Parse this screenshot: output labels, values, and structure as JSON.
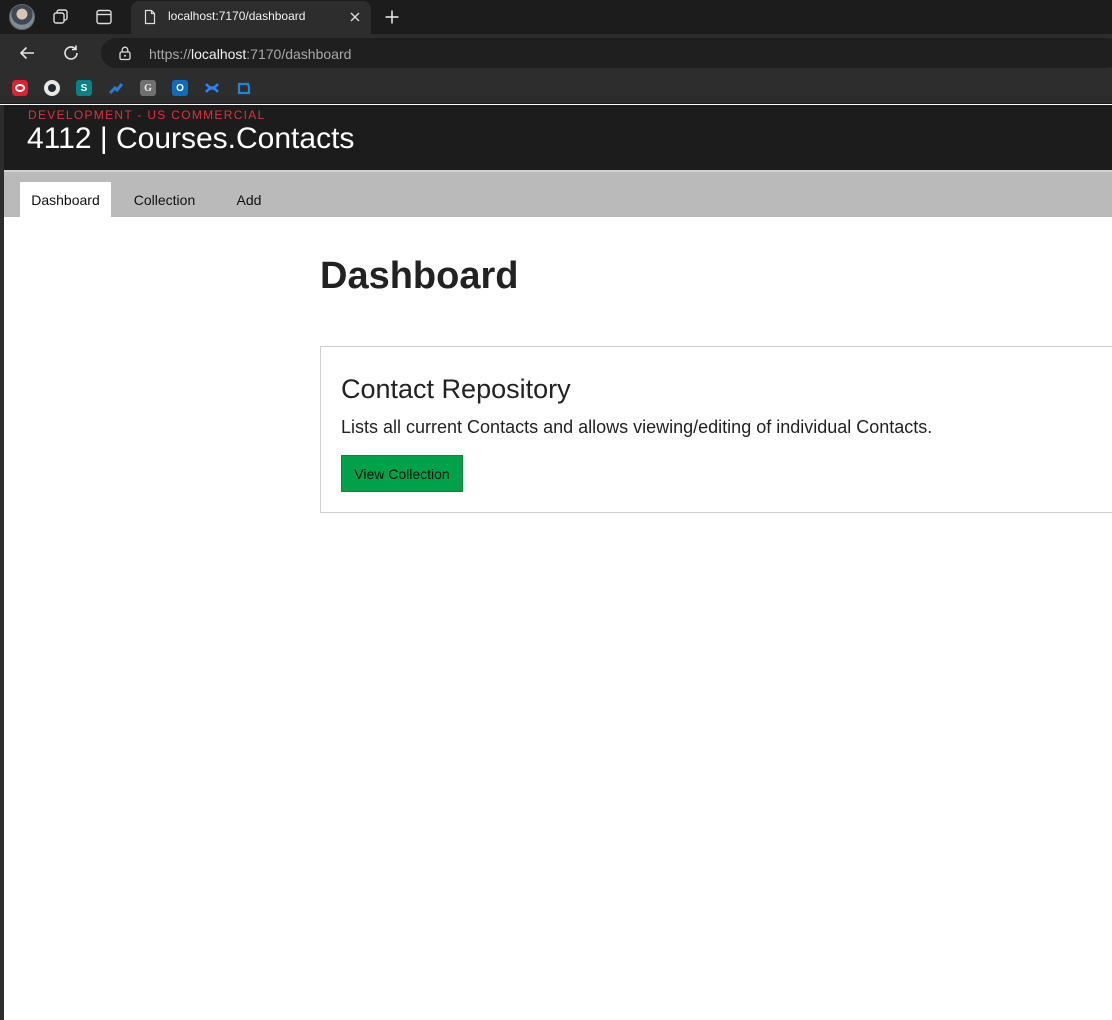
{
  "browser": {
    "tab_title": "localhost:7170/dashboard",
    "url_scheme": "https://",
    "url_host": "localhost",
    "url_rest": ":7170/dashboard",
    "favorites": [
      {
        "name": "opera-favicon",
        "glyph": "O",
        "color": "#e0202a"
      },
      {
        "name": "github-favicon",
        "glyph": "",
        "color": "#e8e8e8"
      },
      {
        "name": "sharepoint-favicon",
        "glyph": "S",
        "color": "#038387"
      },
      {
        "name": "azure-devops-favicon",
        "glyph": "",
        "color": "#2a7ad8"
      },
      {
        "name": "google-favicon",
        "glyph": "G",
        "color": "#707070"
      },
      {
        "name": "outlook-favicon",
        "glyph": "O",
        "color": "#0f6cbd"
      },
      {
        "name": "confluence-favicon",
        "glyph": "",
        "color": "#2684ff"
      },
      {
        "name": "azure-favicon",
        "glyph": "",
        "color": "#1f86d6"
      }
    ]
  },
  "app": {
    "environment": "DEVELOPMENT - US COMMERCIAL",
    "title": "4112 | Courses.Contacts",
    "nav": [
      {
        "label": "Dashboard",
        "active": true
      },
      {
        "label": "Collection",
        "active": false
      },
      {
        "label": "Add",
        "active": false
      }
    ]
  },
  "main": {
    "heading": "Dashboard",
    "card": {
      "title": "Contact Repository",
      "description": "Lists all current Contacts and allows viewing/editing of individual Contacts.",
      "button_label": "View Collection"
    }
  },
  "colors": {
    "env_label": "#e0303b",
    "header_bg": "#1c1c1c",
    "nav_bg": "#bababa",
    "button_bg": "#00a14b"
  }
}
